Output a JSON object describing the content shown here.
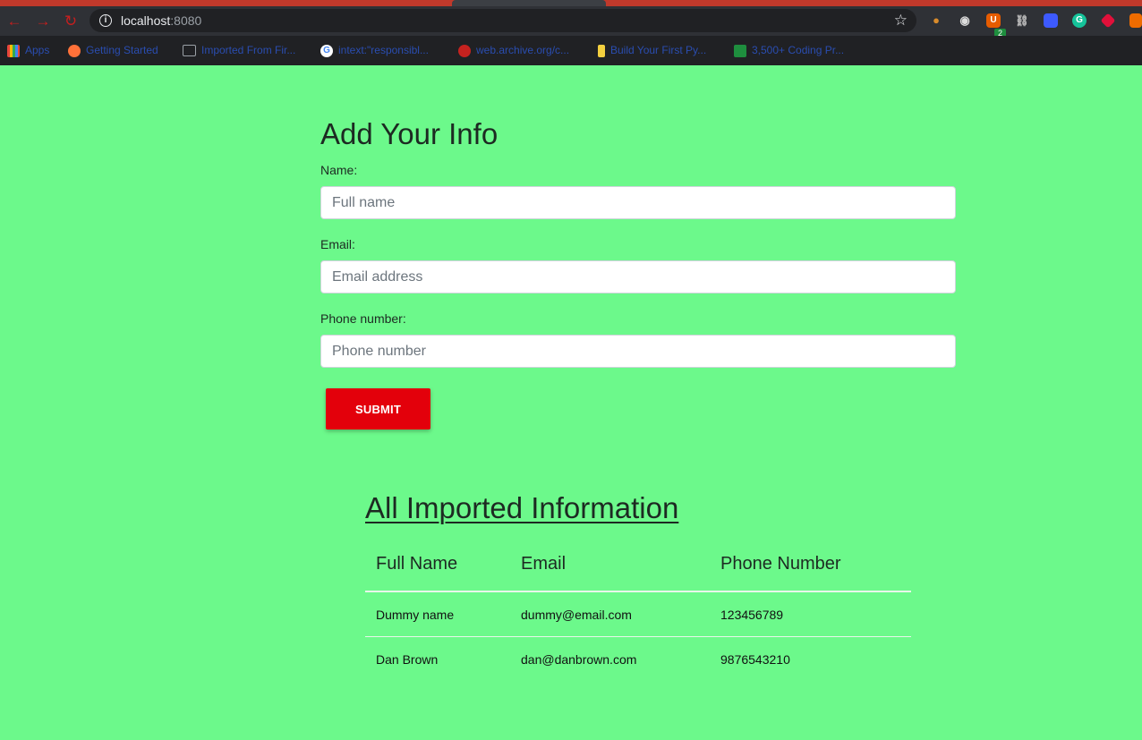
{
  "browser": {
    "url_host": "localhost",
    "url_port": ":8080",
    "extensions": [
      {
        "name": "cookie-icon",
        "glyph": "🍪",
        "color": "#d98b2b"
      },
      {
        "name": "eye-icon",
        "glyph": "◉",
        "color": "#dddddd"
      },
      {
        "name": "ublock-icon",
        "glyph": "U",
        "color": "#e65c00",
        "badge": "2"
      },
      {
        "name": "link-icon",
        "glyph": "⛓",
        "color": "#bbbbbb"
      },
      {
        "name": "monitor-icon",
        "glyph": "▣",
        "color": "#3d5afe"
      },
      {
        "name": "grammarly-icon",
        "glyph": "G",
        "color": "#15c39a"
      },
      {
        "name": "pocket-icon",
        "glyph": "◆",
        "color": "#e1103a"
      },
      {
        "name": "brave-icon",
        "glyph": "▲",
        "color": "#ef6c00"
      }
    ],
    "bookmarks": [
      {
        "label": "Apps",
        "color": "#e8453c"
      },
      {
        "label": "Getting Started",
        "color": "#ff7139"
      },
      {
        "label": "Imported From Fir...",
        "color": "#9aa0a6"
      },
      {
        "label": "intext:\"responsibl...",
        "color": "#4285f4"
      },
      {
        "label": "web.archive.org/c...",
        "color": "#c5221f"
      },
      {
        "label": "Build Your First Py...",
        "color": "#f4d03f"
      },
      {
        "label": "3,500+ Coding Pr...",
        "color": "#1e8e3e"
      }
    ]
  },
  "form": {
    "title": "Add Your Info",
    "name_label": "Name:",
    "name_placeholder": "Full name",
    "email_label": "Email:",
    "email_placeholder": "Email address",
    "phone_label": "Phone number:",
    "phone_placeholder": "Phone number",
    "submit_label": "SUBMIT"
  },
  "table": {
    "title": "All Imported Information",
    "headers": [
      "Full Name",
      "Email",
      "Phone Number"
    ],
    "rows": [
      [
        "Dummy name",
        "dummy@email.com",
        "123456789"
      ],
      [
        "Dan Brown",
        "dan@danbrown.com",
        "9876543210"
      ]
    ]
  },
  "colors": {
    "page_background": "#6cf98b",
    "submit_button": "#e3000b"
  }
}
